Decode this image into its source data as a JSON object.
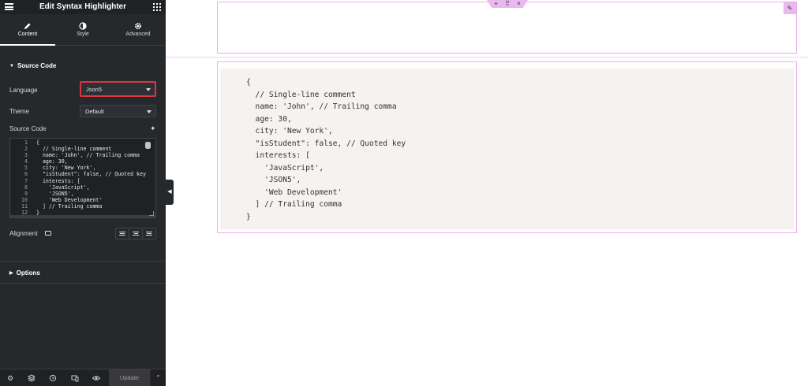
{
  "panel": {
    "title": "Edit Syntax Highlighter",
    "tabs": [
      {
        "label": "Content",
        "icon": "pencil-icon",
        "active": true
      },
      {
        "label": "Style",
        "icon": "half-circle-icon",
        "active": false
      },
      {
        "label": "Advanced",
        "icon": "gear-icon",
        "active": false
      }
    ],
    "source_section": {
      "title": "Source Code",
      "language_label": "Language",
      "language_value": "Json5",
      "theme_label": "Theme",
      "theme_value": "Default",
      "source_label": "Source Code",
      "line_numbers": [
        "1",
        "2",
        "3",
        "4",
        "5",
        "6",
        "7",
        "8",
        "9",
        "10",
        "11",
        "12"
      ],
      "code": "{\n  // Single-line comment\n  name: 'John', // Trailing comma\n  age: 30,\n  city: 'New York',\n  \"isStudent\": false, // Quoted key\n  interests: [\n    'JavaScript',\n    'JSON5',\n    'Web Development'\n  ] // Trailing comma\n}",
      "alignment_label": "Alignment"
    },
    "options_section": {
      "title": "Options"
    },
    "footer": {
      "update_label": "Update"
    }
  },
  "preview": {
    "code": "{\n  // Single-line comment\n  name: 'John', // Trailing comma\n  age: 30,\n  city: 'New York',\n  \"isStudent\": false, // Quoted key\n  interests: [\n    'JavaScript',\n    'JSON5',\n    'Web Development'\n  ] // Trailing comma\n}"
  },
  "colors": {
    "sidebar_bg": "#26292c",
    "highlight_border": "#d9363e",
    "selection_outline": "#e9b0ee",
    "code_bg": "#f5f2f0"
  }
}
